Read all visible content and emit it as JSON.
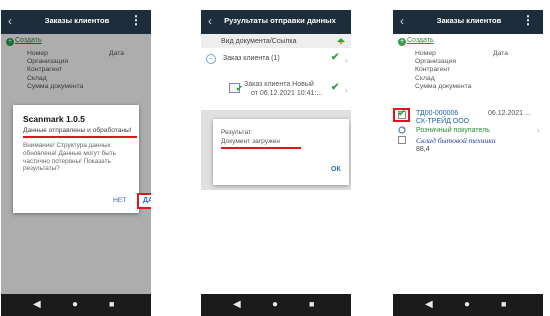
{
  "screen1": {
    "title": "Заказы клиентов",
    "create": "Создать",
    "fields": [
      "Номер",
      "Организация",
      "Контрагент",
      "Склад",
      "Сумма документа"
    ],
    "date_label": "Дата",
    "dialog": {
      "title": "Scanmark 1.0.5",
      "sent": "Данные отправлены и обработаны!",
      "warning": "Внимание! Структура данных обновлена! Данные могут быть частично потеряны! Показать результаты?",
      "no": "НЕТ",
      "yes": "ДА"
    }
  },
  "screen2": {
    "title": "Рузультаты отправки данных",
    "column": "Вид документа/Ссылка",
    "group": "Заказ клиента (1)",
    "doc_line1": "Заказ клиента Новый",
    "doc_line2": "от 06.12.2021 10:41:...",
    "dialog": {
      "label": "Результат:",
      "result": "Документ загружен",
      "ok": "ОК"
    }
  },
  "screen3": {
    "title": "Заказы клиентов",
    "create": "Создать",
    "fields": [
      "Номер",
      "Организация",
      "Контрагент",
      "Склад",
      "Сумма документа"
    ],
    "date_label": "Дата",
    "order": {
      "number": "ТД00-000006",
      "date": "06.12.2021 ...",
      "organization": "СК-ТРЕЙД ООО",
      "counterparty": "Розничный покупатель",
      "warehouse": "Склад бытовой техники",
      "sum": "88,4"
    }
  },
  "icons": {
    "back": "back-chevron",
    "more": "more-vert",
    "check": "checkmark",
    "sync": "sync-arrows"
  },
  "colors": {
    "appbar": "#1e2d3b",
    "accent_red": "#e0151b",
    "link_green": "#2a8a3a",
    "button_blue": "#2b6cb5"
  }
}
